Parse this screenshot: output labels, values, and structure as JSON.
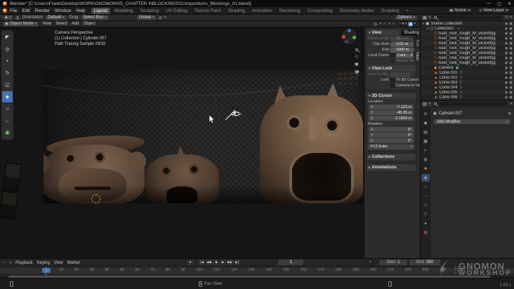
{
  "titlebar": {
    "title": "Blender* [C:\\Users\\Frank\\Desktop\\WORK\\GNOMON\\05_CHAPTER 4\\BLOCKINGS\\Compositions_Blockings_01.blend]"
  },
  "menubar": {
    "menus": [
      "File",
      "Edit",
      "Render",
      "Window",
      "Help"
    ],
    "workspaces": [
      {
        "label": "Layout",
        "cls": "active"
      },
      {
        "label": "Modeling"
      },
      {
        "label": "Sculpting"
      },
      {
        "label": "UV Editing"
      },
      {
        "label": "Texture Paint"
      },
      {
        "label": "Shading"
      },
      {
        "label": "Animation"
      },
      {
        "label": "Rendering"
      },
      {
        "label": "Compositing"
      },
      {
        "label": "Geometry Nodes"
      },
      {
        "label": "Scripting"
      },
      {
        "label": "+"
      }
    ],
    "scene_selector": "Scene",
    "view_layer_selector": "View Layer"
  },
  "tool_settings": {
    "orientation_label": "Orientation",
    "orientation_value": "Default",
    "drag_label": "Drag",
    "drag_value": "Select Box",
    "transform_orientation": "Global",
    "options_label": "Options"
  },
  "viewport_header": {
    "mode": "Object Mode",
    "menus": [
      "View",
      "Select",
      "Add",
      "Object"
    ]
  },
  "viewport": {
    "overlay_lines": [
      "Camera Perspective",
      "(1) Collection | Cylinder.007",
      "Path Tracing Sample 29/32"
    ],
    "shading_tooltip": "Shading"
  },
  "toolbar": {
    "tools": [
      {
        "name": "select-box",
        "glyph": "◤"
      },
      {
        "name": "cursor",
        "glyph": "◎"
      },
      {
        "name": "move",
        "glyph": "+"
      },
      {
        "name": "rotate",
        "glyph": "↻"
      },
      {
        "name": "scale",
        "glyph": "◱"
      },
      {
        "name": "transform",
        "glyph": "◈",
        "cls": "active"
      },
      {
        "name": "annotate",
        "glyph": "▱"
      },
      {
        "name": "measure",
        "glyph": "∟"
      },
      {
        "name": "add-cube",
        "glyph": "▣",
        "cls": "green"
      }
    ]
  },
  "n_panel": {
    "tabs": [
      {
        "label": "Tool"
      },
      {
        "label": "View",
        "cls": "active"
      }
    ],
    "view_title": "View",
    "focal_length_label": "Focal Length",
    "focal_length_value": "50 mm",
    "clip_start_label": "Clip Start",
    "clip_start_value": "0.01 m",
    "clip_end_label": "End",
    "clip_end_value": "1000 m",
    "local_camera_label": "Local Camera",
    "local_camera_value": "Cam...",
    "render_region_label": "Render Region",
    "view_lock_title": "View Lock",
    "lock_to_object_label": "Lock to Obj...",
    "lock_label": "Lock",
    "to_3d_cursor_label": "To 3D Cursor",
    "camera_to_view_label": "Camera to View",
    "cursor_title": "3D Cursor",
    "location_label": "Location:",
    "location_rows": [
      {
        "axis": "X",
        "value": "-7.123 m"
      },
      {
        "axis": "Y",
        "value": "-48.35 m"
      },
      {
        "axis": "Z",
        "value": "0.1869 m"
      }
    ],
    "rotation_label": "Rotation:",
    "rotation_rows": [
      {
        "axis": "X",
        "value": "0°"
      },
      {
        "axis": "Y",
        "value": "0°"
      },
      {
        "axis": "Z",
        "value": "0°"
      }
    ],
    "euler_value": "XYZ Euler",
    "collections_title": "Collections",
    "annotations_title": "Annotations"
  },
  "outliner": {
    "items": [
      {
        "label": "Scene Collection",
        "cls": "lv0",
        "tri": "▾",
        "glyph": "▣",
        "gcolor": "#cfcfcf",
        "noic": ""
      },
      {
        "label": "Collection",
        "cls": "lv1",
        "tri": "▾",
        "glyph": "▢",
        "gcolor": "#e0e0e0",
        "chk": "✓"
      },
      {
        "label": "Aset_rock_rough_M_uk3ndfyga_LOD0",
        "cls": "lv2",
        "glyph": "▽",
        "gcolor": "#e8853c"
      },
      {
        "label": "Aset_rock_rough_M_uk3ndfyga_LOD0",
        "cls": "lv2",
        "glyph": "▽",
        "gcolor": "#e8853c"
      },
      {
        "label": "Aset_rock_rough_M_uk3ndfyga_LOD0",
        "cls": "lv2",
        "glyph": "▽",
        "gcolor": "#e8853c"
      },
      {
        "label": "Aset_rock_rough_M_uk3ndfyga_LOD0",
        "cls": "lv2",
        "glyph": "▽",
        "gcolor": "#e8853c"
      },
      {
        "label": "Aset_rock_rough_M_uk3ndfyga_LOD0",
        "cls": "lv2",
        "glyph": "▽",
        "gcolor": "#e8853c"
      },
      {
        "label": "Aset_rock_rough_M_uk3ndfyga_LOD0",
        "cls": "lv2",
        "glyph": "▽",
        "gcolor": "#e8853c"
      },
      {
        "label": "Aset_rock_rough_M_uk3ndfyga_LOD0",
        "cls": "lv2",
        "glyph": "▽",
        "gcolor": "#e8853c"
      },
      {
        "label": "Camera",
        "cls": "lv2",
        "glyph": "◆",
        "gcolor": "#e8853c",
        "d": "▣",
        "dcolor": "#5fbf6f"
      },
      {
        "label": "Cone.001",
        "cls": "lv2",
        "glyph": "▲",
        "gcolor": "#e8853c",
        "d": "▽",
        "dcolor": "#5fbf6f"
      },
      {
        "label": "Cone.002",
        "cls": "lv2",
        "glyph": "▲",
        "gcolor": "#e8853c",
        "d": "▽",
        "dcolor": "#5fbf6f"
      },
      {
        "label": "Cone.003",
        "cls": "lv2",
        "glyph": "▲",
        "gcolor": "#e8853c",
        "d": "▽",
        "dcolor": "#5fbf6f"
      },
      {
        "label": "Cone.004",
        "cls": "lv2",
        "glyph": "▲",
        "gcolor": "#e8853c",
        "d": "▽",
        "dcolor": "#5fbf6f"
      },
      {
        "label": "Cone.005",
        "cls": "lv2",
        "glyph": "▲",
        "gcolor": "#e8853c",
        "d": "▽",
        "dcolor": "#5fbf6f"
      },
      {
        "label": "Cone.006",
        "cls": "lv2",
        "glyph": "▲",
        "gcolor": "#e8853c",
        "d": "▽",
        "dcolor": "#5fbf6f"
      }
    ]
  },
  "properties": {
    "tabs": [
      {
        "name": "tool",
        "glyph": "⊙",
        "color": "#b0b0b0"
      },
      {
        "name": "render",
        "glyph": "◉",
        "color": "#b0b0b0"
      },
      {
        "name": "output",
        "glyph": "▤",
        "color": "#b0b0b0"
      },
      {
        "name": "view-layer",
        "glyph": "▦",
        "color": "#b0b0b0"
      },
      {
        "name": "scene",
        "glyph": "◐",
        "color": "#b0b0b0"
      },
      {
        "name": "world",
        "glyph": "◍",
        "color": "#9fb8d6"
      },
      {
        "name": "object",
        "glyph": "■",
        "color": "#e8853c"
      },
      {
        "name": "modifiers",
        "glyph": "◆",
        "color": "#7aa5dd",
        "cls": "active"
      },
      {
        "name": "particles",
        "glyph": "○",
        "color": "#7aa5dd"
      },
      {
        "name": "physics",
        "glyph": "◔",
        "color": "#7aa5dd"
      },
      {
        "name": "constraints",
        "glyph": "◇",
        "color": "#b0b0b0"
      },
      {
        "name": "data",
        "glyph": "▽",
        "color": "#5fbf6f"
      },
      {
        "name": "material",
        "glyph": "●",
        "color": "#d98a8a"
      },
      {
        "name": "texture",
        "glyph": "▩",
        "color": "#c0524f"
      }
    ],
    "object_name": "Cylinder.007",
    "add_modifier_label": "Add Modifier"
  },
  "timeline": {
    "menus": [
      {
        "label": "Playback",
        "cls": "chev"
      },
      {
        "label": "Keying",
        "cls": "chev"
      },
      {
        "label": "View"
      },
      {
        "label": "Marker"
      }
    ],
    "record_glyph": "●",
    "playback_buttons": [
      {
        "name": "jump-to-start",
        "glyph": "|◀"
      },
      {
        "name": "prev-keyframe",
        "glyph": "◀◀"
      },
      {
        "name": "play-reverse",
        "glyph": "◀"
      },
      {
        "name": "play",
        "glyph": "▶"
      },
      {
        "name": "next-keyframe",
        "glyph": "▶▶"
      },
      {
        "name": "jump-to-end",
        "glyph": "▶|"
      }
    ],
    "current_frame": "1",
    "start_label": "Start",
    "start_value": "1",
    "end_label": "End",
    "end_value": "250",
    "first_tick": "1",
    "ticks": [
      "10",
      "20",
      "30",
      "40",
      "50",
      "60",
      "70",
      "80",
      "90",
      "100",
      "110",
      "120",
      "130",
      "140",
      "150",
      "160",
      "170",
      "180",
      "190",
      "200",
      "210",
      "220",
      "230",
      "240",
      "250"
    ]
  },
  "status_bar": {
    "pan_view_label": "Pan View",
    "version": "2.93.1"
  },
  "watermark": {
    "the": "THE",
    "name": "GNOMON",
    "suffix": "WORKSHOP"
  }
}
